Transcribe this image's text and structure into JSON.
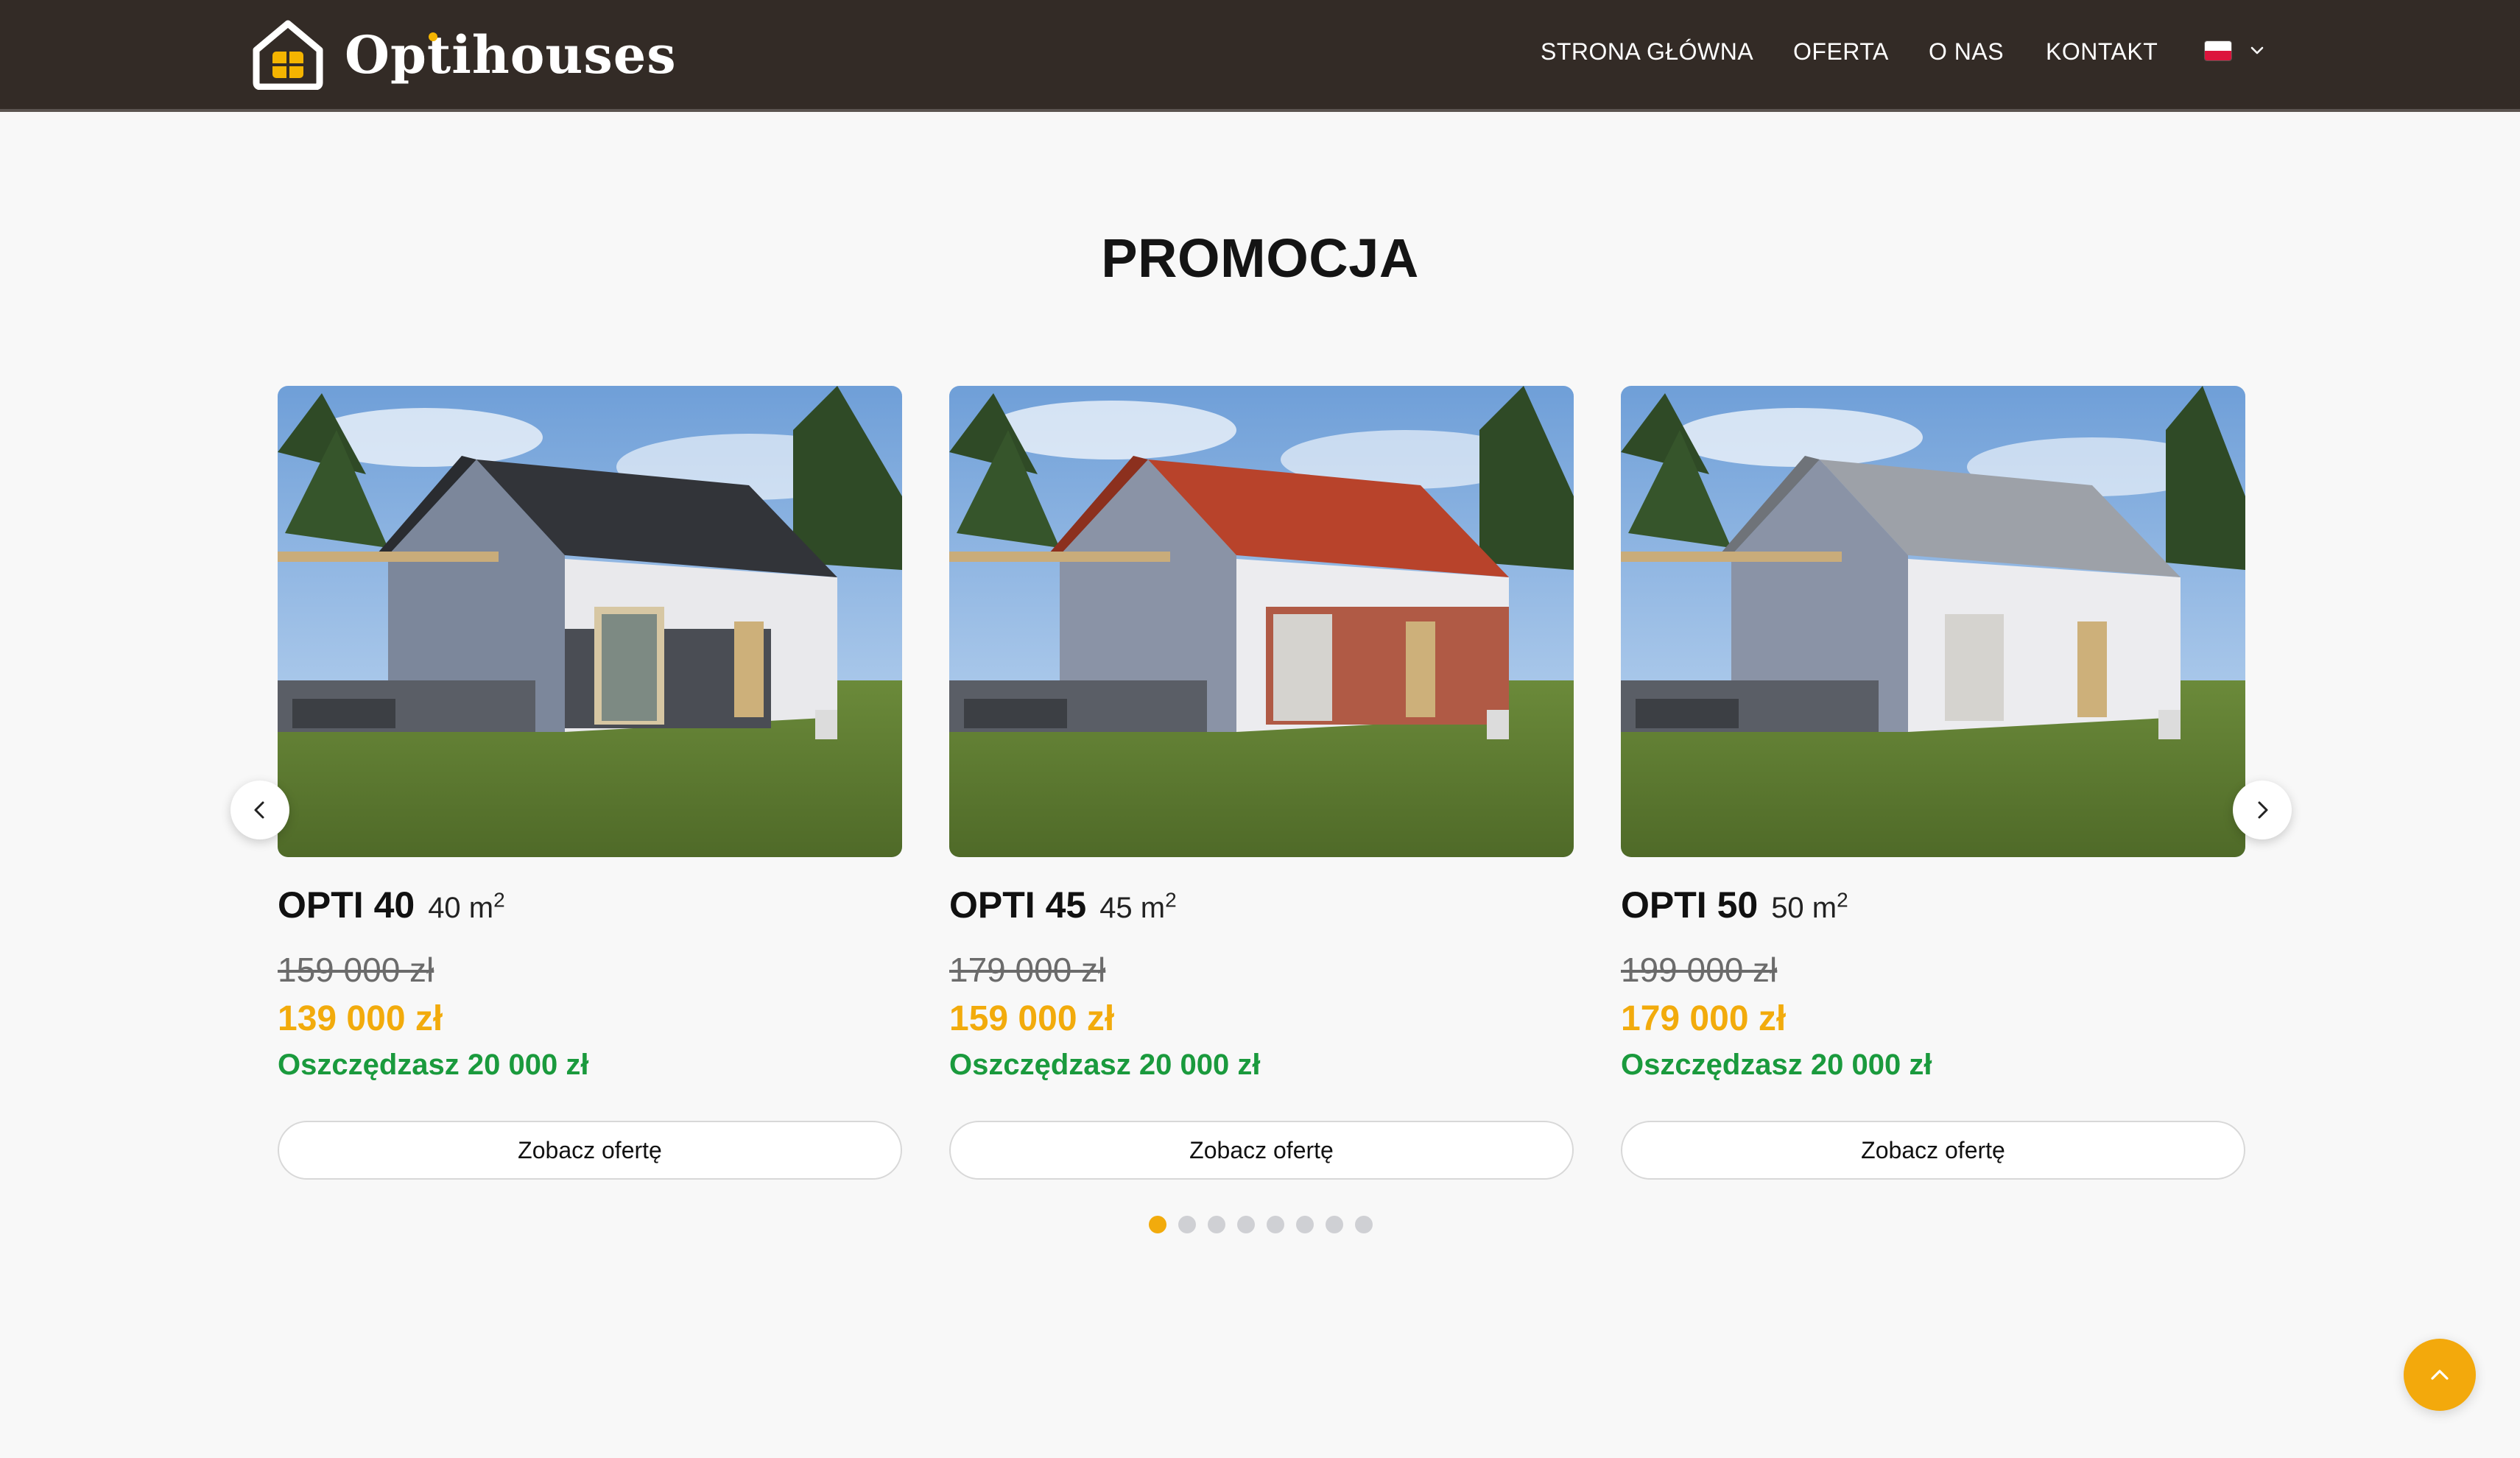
{
  "header": {
    "logo_text": "Optihouses",
    "nav": [
      {
        "label": "STRONA GŁÓWNA"
      },
      {
        "label": "OFERTA"
      },
      {
        "label": "O NAS"
      },
      {
        "label": "KONTAKT"
      }
    ],
    "language": {
      "flag_icon": "poland-flag-icon",
      "chevron_icon": "chevron-down-icon"
    }
  },
  "section": {
    "title": "PROMOCJA"
  },
  "cards": [
    {
      "name": "OPTI 40",
      "area": "40 m",
      "area_sup": "2",
      "old_price": "159 000 zł",
      "new_price": "139 000 zł",
      "savings": "Oszczędzasz 20 000 zł",
      "button": "Zobacz ofertę",
      "roof": "dark"
    },
    {
      "name": "OPTI 45",
      "area": "45 m",
      "area_sup": "2",
      "old_price": "179 000 zł",
      "new_price": "159 000 zł",
      "savings": "Oszczędzasz 20 000 zł",
      "button": "Zobacz ofertę",
      "roof": "red"
    },
    {
      "name": "OPTI 50",
      "area": "50 m",
      "area_sup": "2",
      "old_price": "199 000 zł",
      "new_price": "179 000 zł",
      "savings": "Oszczędzasz 20 000 zł",
      "button": "Zobacz ofertę",
      "roof": "grey"
    }
  ],
  "carousel": {
    "dots_total": 8,
    "active_dot": 1,
    "prev_icon": "chevron-left-icon",
    "next_icon": "chevron-right-icon"
  },
  "colors": {
    "header_bg": "#332b26",
    "accent": "#f2ab0c",
    "savings": "#1a9a3d",
    "page_bg": "#f8f8f8"
  },
  "scroll_top_icon": "chevron-up-icon"
}
